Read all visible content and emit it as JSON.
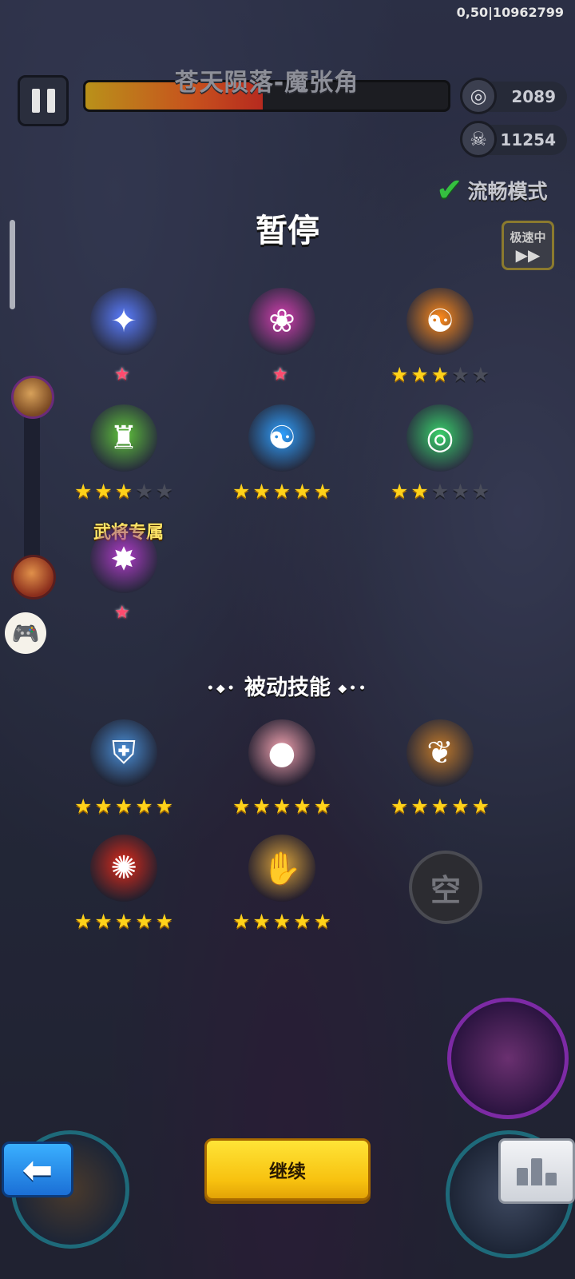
{
  "debug": {
    "text": "0,50|10962799"
  },
  "hud": {
    "boss_name": "苍天陨落-魔张角",
    "boss_hp_fraction": 0.49,
    "coins": "2089",
    "kills": "11254",
    "smooth_mode_label": "流畅模式",
    "speed_label": "极速中"
  },
  "pause": {
    "title": "暂停",
    "exclusive_label": "武将专属",
    "passive_header": "被动技能",
    "continue_label": "继续",
    "void_button_label": "空"
  },
  "active_skills": [
    {
      "name": "ice-spear-skill",
      "icon": "ice-spear-icon",
      "color": "#5a7dff",
      "glyph": "✦",
      "rank": "star-badge",
      "stars": null
    },
    {
      "name": "flame-fan-skill",
      "icon": "flame-fan-icon",
      "color": "#d43fb0",
      "glyph": "❀",
      "rank": "star-badge",
      "stars": null
    },
    {
      "name": "fire-yinyang-girl-skill",
      "icon": "yinyang-girl-fire-icon",
      "color": "#ff8a1a",
      "glyph": "☯",
      "rank": "stars",
      "stars": 3
    },
    {
      "name": "jade-tower-skill",
      "icon": "jade-tower-icon",
      "color": "#5fc33a",
      "glyph": "♜",
      "rank": "stars",
      "stars": 3
    },
    {
      "name": "water-yinyang-girl-skill",
      "icon": "yinyang-girl-water-icon",
      "color": "#2fa0ff",
      "glyph": "☯",
      "rank": "stars",
      "stars": 5
    },
    {
      "name": "wind-tornado-skill",
      "icon": "tornado-icon",
      "color": "#39d06a",
      "glyph": "◎",
      "rank": "stars",
      "stars": 2
    },
    {
      "name": "general-exclusive-skill",
      "icon": "purple-fire-fan-icon",
      "color": "#b03cc9",
      "glyph": "✸",
      "rank": "star-badge",
      "stars": null
    }
  ],
  "passive_skills": [
    {
      "name": "armor-passive",
      "icon": "armor-icon",
      "color": "#4a8fd8",
      "glyph": "⛨",
      "stars": 5
    },
    {
      "name": "peach-passive",
      "icon": "peach-icon",
      "color": "#f3a3b0",
      "glyph": "●",
      "stars": 5
    },
    {
      "name": "ginseng-passive",
      "icon": "ginseng-icon",
      "color": "#c27a2a",
      "glyph": "❦",
      "stars": 5
    },
    {
      "name": "fire-orb-passive",
      "icon": "fire-swirl-icon",
      "color": "#e02a1a",
      "glyph": "✺",
      "stars": 5
    },
    {
      "name": "bracer-passive",
      "icon": "bracer-icon",
      "color": "#d9a23a",
      "glyph": "✋",
      "stars": 5
    }
  ],
  "max_stars": 5
}
